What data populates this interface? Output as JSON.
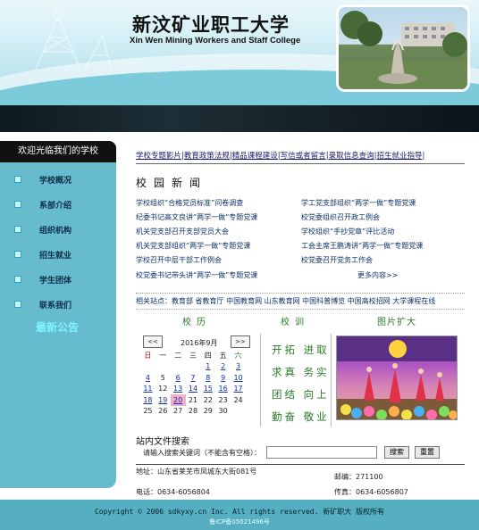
{
  "header": {
    "title_cn": "新汶矿业职工大学",
    "title_en": "Xin Wen Mining Workers and Staff College"
  },
  "sidebar": {
    "welcome": "欢迎光临我们的学校",
    "items": [
      {
        "label": "学校概况"
      },
      {
        "label": "系部介绍"
      },
      {
        "label": "组织机构"
      },
      {
        "label": "招生就业"
      },
      {
        "label": "学生团体"
      },
      {
        "label": "联系我们"
      }
    ],
    "announcement_title": "最新公告"
  },
  "topnav": {
    "links": [
      "学校专题影片",
      "教育政策法规",
      "精品课程建设",
      "写信或者留言",
      "录取信息查询",
      "招生就业指导"
    ]
  },
  "news": {
    "title": "校园新闻",
    "left": [
      "学校组织“合格党员标准”问卷调查",
      "纪委书记高文良讲“两学一做”专题党课",
      "机关党支部召开支部党员大会",
      "机关党支部组织“两学一做”专题党课",
      "学校召开中层干部工作例会",
      "校党委书记带头讲“两学一做”专题党课"
    ],
    "right": [
      "学工党支部组织“两学一做”专题党课",
      "校党委组织召开政工例会",
      "学校组织“手抄党章”评比活动",
      "工会主席王鹏涛讲“两学一做”专题党课",
      "校党委召开党务工作会",
      ""
    ],
    "more": "更多内容>>"
  },
  "related": "相关站点：教育部 省教育厅 中国教育网 山东教育网 中国科普博览 中国高校招网 大学课程在线",
  "tabs": {
    "calendar": "校历",
    "motto": "校训",
    "photo": "图片扩大"
  },
  "calendar": {
    "prev": "<<",
    "next": ">>",
    "month": "2016年9月",
    "weekdays": [
      "日",
      "一",
      "二",
      "三",
      "四",
      "五",
      "六"
    ],
    "weeks": [
      [
        "",
        "",
        "",
        "",
        "1",
        "2",
        "3"
      ],
      [
        "4",
        "5",
        "6",
        "7",
        "8",
        "9",
        "10"
      ],
      [
        "11",
        "12",
        "13",
        "14",
        "15",
        "16",
        "17"
      ],
      [
        "18",
        "19",
        "20",
        "21",
        "22",
        "23",
        "24"
      ],
      [
        "25",
        "26",
        "27",
        "28",
        "29",
        "30",
        ""
      ]
    ],
    "today": "20"
  },
  "motto": [
    "开拓",
    "进取",
    "求真",
    "务实",
    "团结",
    "向上",
    "勤奋",
    "敬业"
  ],
  "search": {
    "title": "站内文件搜索",
    "prompt": "请输入搜索关键词（不能含有空格）：",
    "search_label": "搜索",
    "reset_label": "重置",
    "value": ""
  },
  "contact": {
    "address": "地址：山东省莱芜市凤城东大街081号",
    "phone": "电话：0634-6056804",
    "postcode": "邮编：271100",
    "fax": "传真：0634-6056807"
  },
  "footer": {
    "copyright": "Copyright © 2006 sdkyxy.cn Inc. All rights reserved. 新矿职大 版权所有",
    "icp": "鲁ICP备05021496号"
  },
  "colors": {
    "sidebar": "#66bccd",
    "footer": "#55afc0",
    "band": "#0d1a20",
    "accent_green": "#2a7a2a"
  }
}
